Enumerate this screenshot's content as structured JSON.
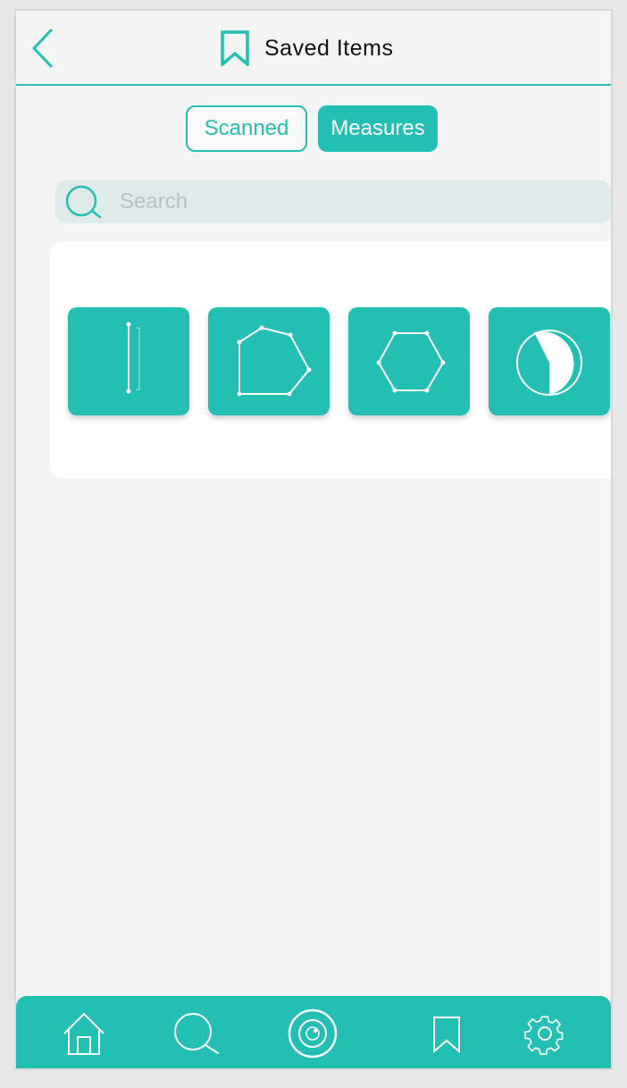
{
  "header": {
    "title": "Saved Items",
    "back_icon": "chevron-left-icon",
    "title_icon": "bookmark-icon"
  },
  "tabs": [
    {
      "label": "Scanned",
      "active": false
    },
    {
      "label": "Measures",
      "active": true
    }
  ],
  "search": {
    "placeholder": "Search",
    "value": ""
  },
  "measures": [
    {
      "icon": "ruler-line-icon"
    },
    {
      "icon": "polygon-pentagon-icon"
    },
    {
      "icon": "hexagon-icon"
    },
    {
      "icon": "circle-sector-icon"
    }
  ],
  "bottom_nav": [
    {
      "icon": "home-icon"
    },
    {
      "icon": "search-icon"
    },
    {
      "icon": "camera-icon"
    },
    {
      "icon": "bookmark-icon"
    },
    {
      "icon": "settings-gear-icon"
    }
  ],
  "colors": {
    "accent": "#22bfb2",
    "background": "#f4f4f4",
    "search_bg": "#dfeaea"
  }
}
